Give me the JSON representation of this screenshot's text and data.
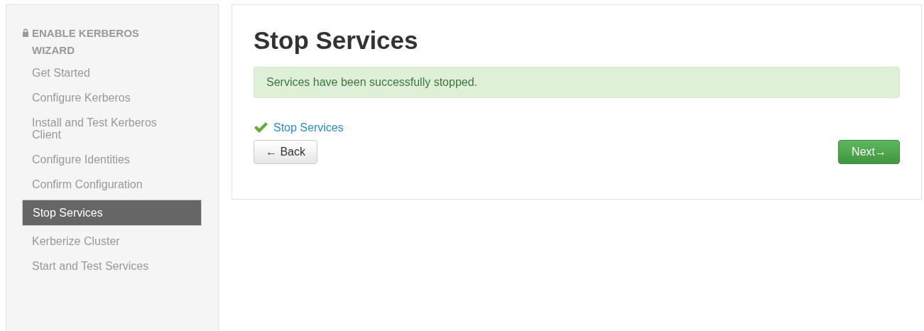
{
  "sidebar": {
    "title": "ENABLE KERBEROS WIZARD",
    "items": [
      {
        "label": "Get Started",
        "selected": false
      },
      {
        "label": "Configure Kerberos",
        "selected": false
      },
      {
        "label": "Install and Test Kerberos Client",
        "selected": false
      },
      {
        "label": "Configure Identities",
        "selected": false
      },
      {
        "label": "Confirm Configuration",
        "selected": false
      },
      {
        "label": "Stop Services",
        "selected": true
      },
      {
        "label": "Kerberize Cluster",
        "selected": false
      },
      {
        "label": "Start and Test Services",
        "selected": false
      }
    ]
  },
  "main": {
    "heading": "Stop Services",
    "alert": "Services have been successfully stopped.",
    "tasks": [
      {
        "label": "Stop Services",
        "done": true
      }
    ],
    "back_button": "← Back",
    "next_button": "Next→"
  }
}
